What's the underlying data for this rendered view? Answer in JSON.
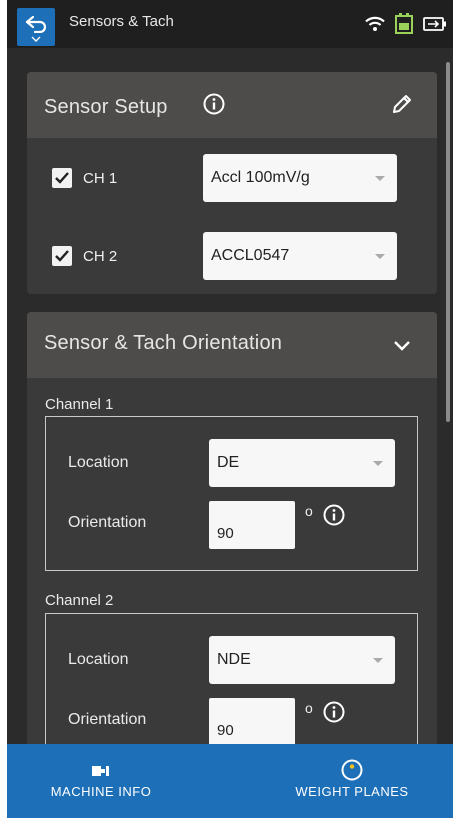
{
  "appbar": {
    "title": "Sensors & Tach"
  },
  "sensor_setup": {
    "title": "Sensor Setup",
    "channels": [
      {
        "label": "CH 1",
        "checked": true,
        "sensor": "Accl 100mV/g"
      },
      {
        "label": "CH 2",
        "checked": true,
        "sensor": "ACCL0547"
      }
    ]
  },
  "orientation": {
    "title": "Sensor & Tach Orientation",
    "location_label": "Location",
    "orientation_label": "Orientation",
    "degree_symbol": "o",
    "channels": [
      {
        "label": "Channel 1",
        "location": "DE",
        "orientation": "90"
      },
      {
        "label": "Channel 2",
        "location": "NDE",
        "orientation": "90"
      }
    ]
  },
  "bottom_nav": {
    "items": [
      {
        "label": "MACHINE INFO",
        "icon": "machine-icon"
      },
      {
        "label": "WEIGHT PLANES",
        "icon": "weight-planes-icon"
      }
    ]
  },
  "colors": {
    "accent": "#1d6fb8",
    "battery": "#9bd35a",
    "card_header": "#4e4c4a",
    "card_body": "#3a3a3a"
  }
}
